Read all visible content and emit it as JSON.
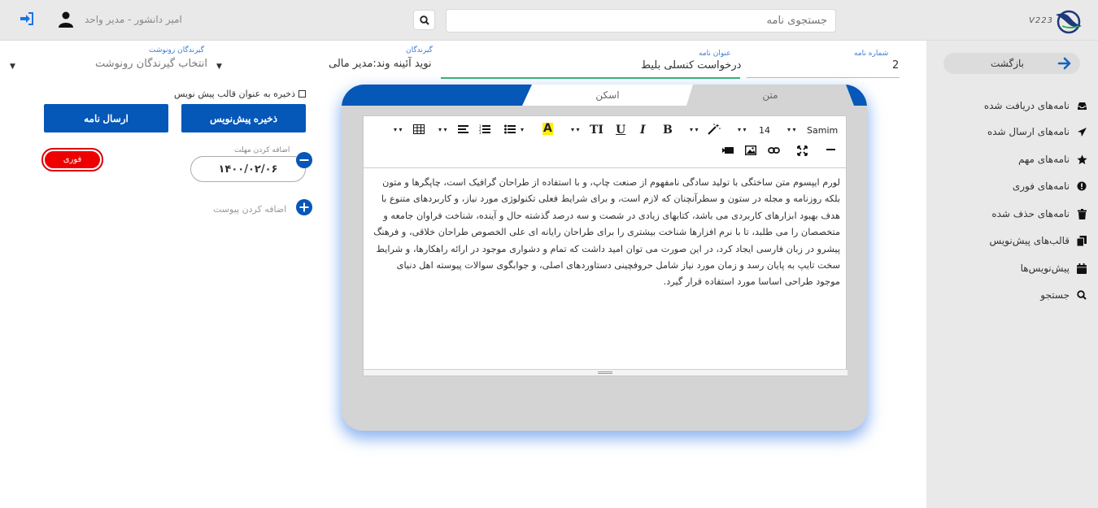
{
  "header": {
    "user_name": "امیر دانشور - مدیر واحد",
    "search_placeholder": "جستجوی نامه",
    "brand_text": "V223"
  },
  "sidebar": {
    "back_label": "بازگشت",
    "items": [
      {
        "label": "نامه‌های دریافت شده",
        "icon": "inbox-icon"
      },
      {
        "label": "نامه‌های ارسال شده",
        "icon": "paper-plane-icon"
      },
      {
        "label": "نامه‌های مهم",
        "icon": "star-icon"
      },
      {
        "label": "نامه‌های فوری",
        "icon": "exclamation-circle-icon"
      },
      {
        "label": "نامه‌های حذف شده",
        "icon": "trash-icon"
      },
      {
        "label": "قالب‌های پیش‌نویس",
        "icon": "copy-icon"
      },
      {
        "label": "پیش‌نویس‌ها",
        "icon": "calendar-icon"
      },
      {
        "label": "جستجو",
        "icon": "search-icon"
      }
    ]
  },
  "form": {
    "letter_number_label": "شماره نامه",
    "letter_number": "2",
    "subject_label": "عنوان نامه",
    "subject": "درخواست کنسلی بلیط",
    "recipients_label": "گیرندگان",
    "recipients": "نوید آئینه وند:مدیر مالی",
    "cc_label": "گیرندگان رونوشت",
    "cc_placeholder": "انتخاب گیرندگان رونوشت"
  },
  "actions": {
    "save_template_label": "ذخیره به عنوان قالب پیش نویس",
    "save_draft": "ذخیره پیش‌نویس",
    "send": "ارسال نامه",
    "urgent": "فوری",
    "deadline_label": "اضافه کردن مهلت",
    "deadline_value": "۱۴۰۰/۰۲/۰۶",
    "attach_label": "اضافه کردن پیوست"
  },
  "editor": {
    "tab_text": "متن",
    "tab_scan": "اسکن",
    "font_name": "Samim",
    "font_size": "14",
    "body": "لورم ایپسوم متن ساختگی با تولید سادگی نامفهوم از صنعت چاپ، و با استفاده از طراحان گرافیک است، چاپگرها و متون بلکه روزنامه و مجله در ستون و سطرآنچنان که لازم است، و برای شرایط فعلی تکنولوژی مورد نیاز، و کاربردهای متنوع با هدف بهبود ابزارهای کاربردی می باشد، کتابهای زیادی در شصت و سه درصد گذشته حال و آینده، شناخت فراوان جامعه و متخصصان را می طلبد، تا با نرم افزارها شناخت بیشتری را برای طراحان رایانه ای علی الخصوص طراحان خلاقی، و فرهنگ پیشرو در زبان فارسی ایجاد کرد، در این صورت می توان امید داشت که تمام و دشواری موجود در ارائه راهکارها، و شرایط سخت تایپ به پایان رسد و زمان مورد نیاز شامل حروفچینی دستاوردهای اصلی، و جوابگوی سوالات پیوسته اهل دنیای موجود طراحی اساسا مورد استفاده قرار گیرد."
  },
  "colors": {
    "primary": "#0557b8",
    "urgent": "#ee0000",
    "sidebar_bg": "#e9e9ea",
    "active_line": "#3cb371"
  }
}
